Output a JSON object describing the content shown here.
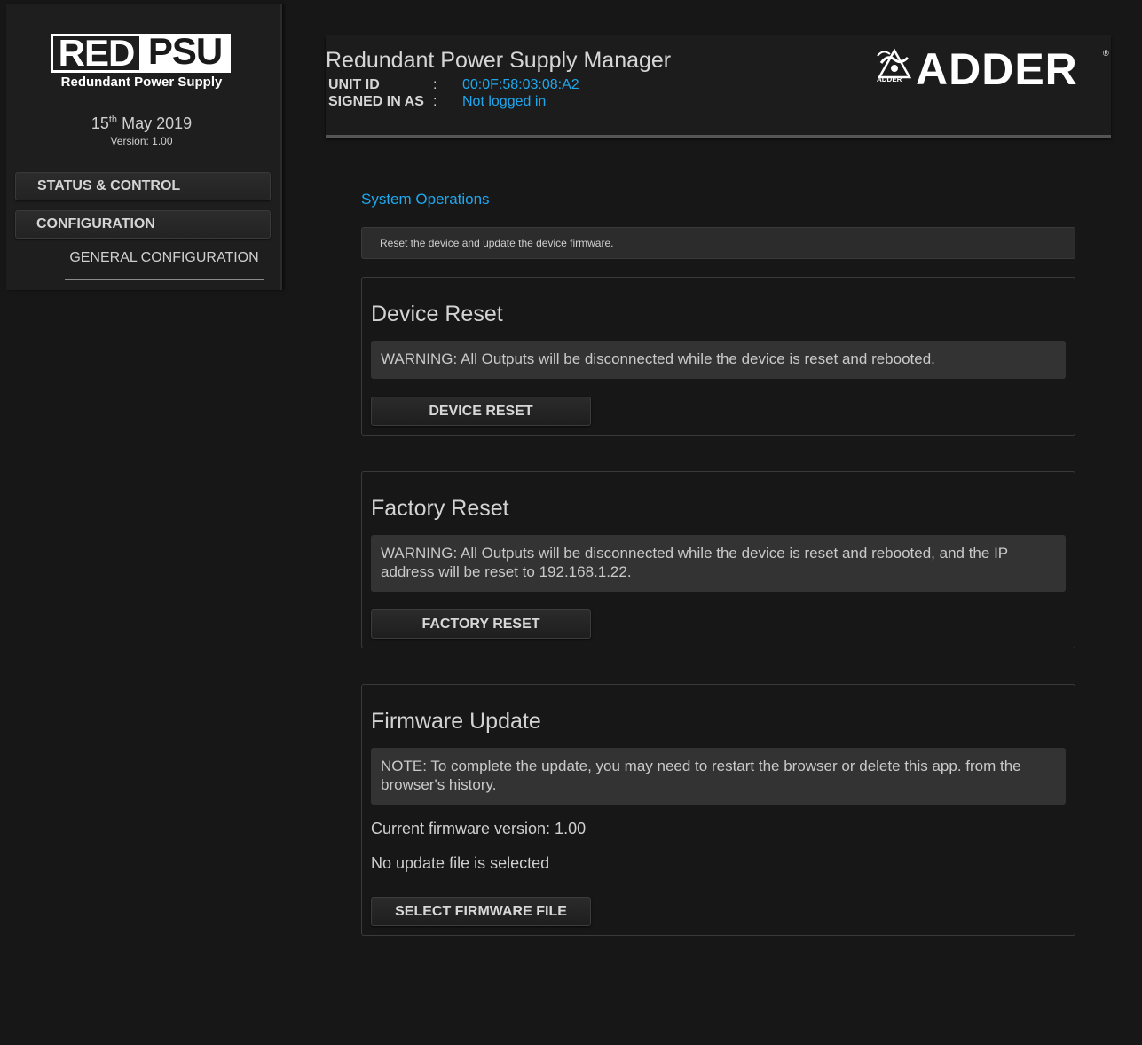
{
  "sidebar": {
    "logo_left": "RED",
    "logo_right": "PSU",
    "logo_subtitle": "Redundant Power Supply",
    "date_day": "15",
    "date_suffix": "th",
    "date_rest": "May 2019",
    "version": "Version: 1.00",
    "nav": {
      "status_control": "STATUS & CONTROL",
      "configuration": "CONFIGURATION",
      "general_configuration": "GENERAL CONFIGURATION"
    }
  },
  "header": {
    "title": "Redundant Power Supply Manager",
    "unit_id_label": "UNIT ID",
    "unit_id_value": "00:0F:58:03:08:A2",
    "signed_in_label": "SIGNED IN AS",
    "signed_in_value": "Not logged in",
    "separator": ":",
    "brand": "ADDER",
    "brand_small": "ADDER",
    "brand_reg": "®"
  },
  "main": {
    "section_title": "System Operations",
    "info": "Reset the device and update the device firmware.",
    "device_reset": {
      "title": "Device Reset",
      "warning": "WARNING: All Outputs will be disconnected while the device is reset and rebooted.",
      "button": "DEVICE RESET"
    },
    "factory_reset": {
      "title": "Factory Reset",
      "warning": "WARNING: All Outputs will be disconnected while the device is reset and rebooted, and the IP address will be reset to 192.168.1.22.",
      "button": "FACTORY RESET"
    },
    "firmware_update": {
      "title": "Firmware Update",
      "note": "NOTE: To complete the update, you may need to restart the browser or delete this app. from the browser's history.",
      "current_version": "Current firmware version: 1.00",
      "file_status": "No update file is selected",
      "button": "SELECT FIRMWARE FILE"
    }
  },
  "colors": {
    "accent": "#1ea8f0",
    "background": "#171717"
  }
}
